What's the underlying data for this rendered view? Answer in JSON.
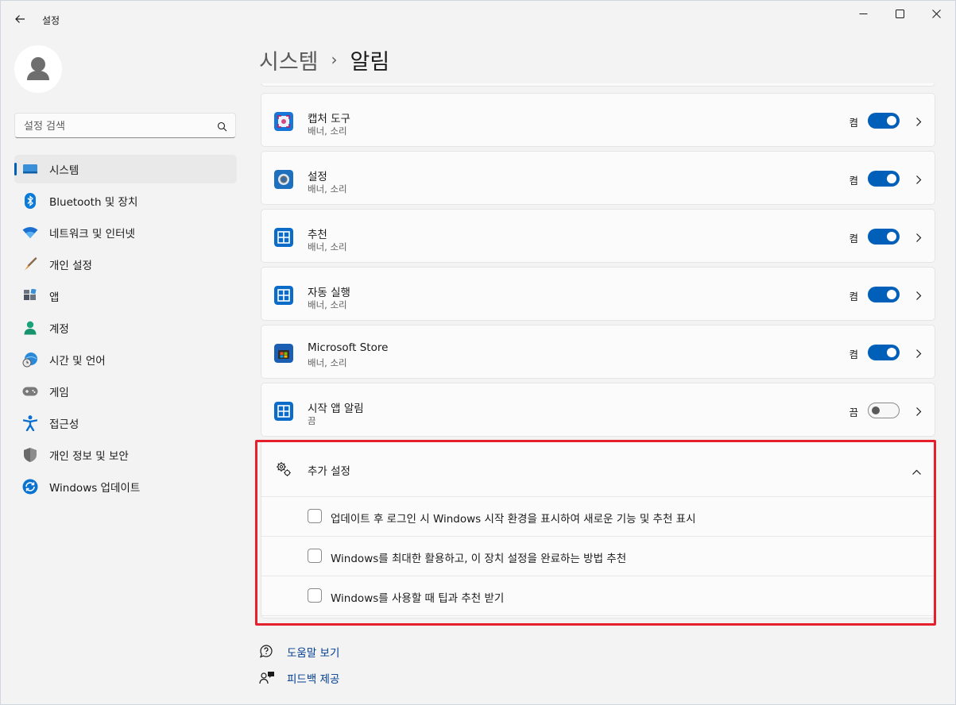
{
  "window": {
    "title": "설정",
    "icons": {
      "back": "back-arrow-icon",
      "minimize": "minimize-icon",
      "maximize": "maximize-icon",
      "close": "close-icon"
    }
  },
  "search": {
    "placeholder": "설정 검색",
    "icon": "search-icon"
  },
  "sidebar": {
    "items": [
      {
        "label": "시스템",
        "icon": "system-monitor-icon",
        "active": true
      },
      {
        "label": "Bluetooth 및 장치",
        "icon": "bluetooth-icon"
      },
      {
        "label": "네트워크 및 인터넷",
        "icon": "wifi-icon"
      },
      {
        "label": "개인 설정",
        "icon": "paintbrush-icon"
      },
      {
        "label": "앱",
        "icon": "apps-icon"
      },
      {
        "label": "계정",
        "icon": "account-icon"
      },
      {
        "label": "시간 및 언어",
        "icon": "globe-clock-icon"
      },
      {
        "label": "게임",
        "icon": "gamepad-icon"
      },
      {
        "label": "접근성",
        "icon": "accessibility-icon"
      },
      {
        "label": "개인 정보 및 보안",
        "icon": "shield-icon"
      },
      {
        "label": "Windows 업데이트",
        "icon": "windows-update-icon"
      }
    ]
  },
  "header": {
    "parent": "시스템",
    "separator": "›",
    "current": "알림"
  },
  "apps": [
    {
      "name": "캡처 도구",
      "subtitle": "배너, 소리",
      "state": "켬",
      "on": true,
      "icon": "snipping-tool-icon"
    },
    {
      "name": "설정",
      "subtitle": "배너, 소리",
      "state": "켬",
      "on": true,
      "icon": "settings-gear-icon"
    },
    {
      "name": "추천",
      "subtitle": "배너, 소리",
      "state": "켬",
      "on": true,
      "icon": "windows-app-icon"
    },
    {
      "name": "자동 실행",
      "subtitle": "배너, 소리",
      "state": "켬",
      "on": true,
      "icon": "windows-app-icon"
    },
    {
      "name": "Microsoft Store",
      "subtitle": "배너, 소리",
      "state": "켬",
      "on": true,
      "icon": "store-icon"
    },
    {
      "name": "시작 앱 알림",
      "subtitle": "끔",
      "state": "끔",
      "on": false,
      "icon": "windows-app-icon"
    }
  ],
  "additional": {
    "title": "추가 설정",
    "icon": "gears-icon",
    "expanded": true,
    "options": [
      {
        "label": "업데이트 후 로그인 시 Windows 시작 환경을 표시하여 새로운 기능 및 추천 표시",
        "checked": false
      },
      {
        "label": "Windows를 최대한 활용하고, 이 장치 설정을 완료하는 방법 추천",
        "checked": false
      },
      {
        "label": "Windows를 사용할 때 팁과 추천 받기",
        "checked": false
      }
    ]
  },
  "footer": {
    "help": {
      "label": "도움말 보기",
      "icon": "help-icon"
    },
    "feedback": {
      "label": "피드백 제공",
      "icon": "feedback-icon"
    }
  },
  "colors": {
    "accent": "#005fb8",
    "highlight_border": "#e5202c",
    "link": "#003e92",
    "background": "#f3f3f3",
    "card": "#fbfbfb"
  }
}
